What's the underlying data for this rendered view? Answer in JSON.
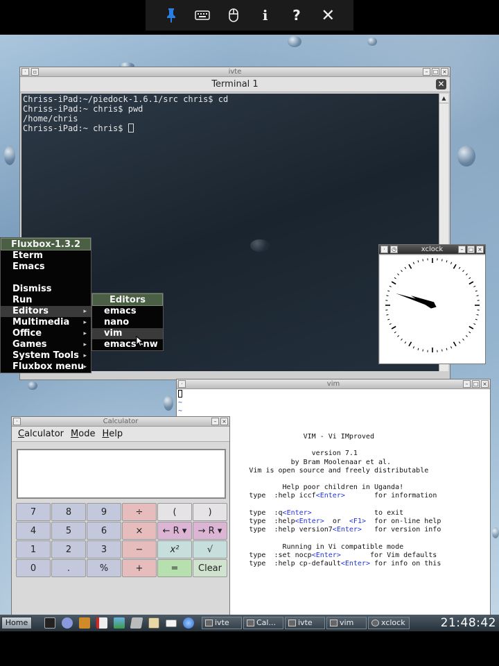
{
  "toolbar": {
    "icons": [
      "pin-icon",
      "keyboard-icon",
      "mouse-icon",
      "info-icon",
      "help-icon",
      "close-icon"
    ],
    "info_glyph": "i",
    "help_glyph": "?",
    "close_glyph": "✕",
    "accent_color": "#2a7de1"
  },
  "terminal": {
    "window_title": "ivte",
    "tab_title": "Terminal 1",
    "lines": [
      "Chriss-iPad:~/piedock-1.6.1/src chris$ cd",
      "Chriss-iPad:~ chris$ pwd",
      "/home/chris"
    ],
    "prompt": "Chriss-iPad:~ chris$ "
  },
  "fluxbox_menu": {
    "title": "Fluxbox-1.3.2",
    "items": [
      "Eterm",
      "Emacs",
      "",
      "Dismiss",
      "Run",
      "Editors",
      "Multimedia",
      "Office",
      "Games",
      "System Tools",
      "Fluxbox menu"
    ]
  },
  "editors_menu": {
    "title": "Editors",
    "items": [
      "emacs",
      "nano",
      "vim",
      "emacs -nw"
    ]
  },
  "xclock": {
    "window_title": "xclock",
    "time_shown": "21:48"
  },
  "vim": {
    "window_title": "vim",
    "tilde_lines": 2,
    "intro": [
      "VIM - Vi IMproved",
      "",
      "version 7.1",
      "by Bram Moolenaar et al.",
      "Vim is open source and freely distributable",
      "",
      "Help poor children in Uganda!"
    ],
    "help_rows": [
      {
        "type": "type",
        "cmd": ":help iccf",
        "key": "<Enter>",
        "desc": "for information"
      },
      {
        "type": "type",
        "cmd": ":q",
        "key": "<Enter>",
        "desc": "to exit"
      },
      {
        "type": "type",
        "cmd": ":help",
        "key": "<Enter>",
        "extra": "or",
        "key2": "<F1>",
        "desc": "for on-line help"
      },
      {
        "type": "type",
        "cmd": ":help version7",
        "key": "<Enter>",
        "desc": "for version info"
      },
      {
        "type": "type",
        "cmd": ":set nocp",
        "key": "<Enter>",
        "desc": "for Vim defaults"
      },
      {
        "type": "type",
        "cmd": ":help cp-default",
        "key": "<Enter>",
        "desc": "for info on this"
      }
    ],
    "compat_notice": "Running in Vi compatible mode"
  },
  "calculator": {
    "window_title": "Calculator",
    "menus": [
      "Calculator",
      "Mode",
      "Help"
    ],
    "menu_underlines": [
      "C",
      "M",
      "H"
    ],
    "display_value": "",
    "keys": [
      {
        "label": "7",
        "kind": "num"
      },
      {
        "label": "8",
        "kind": "num"
      },
      {
        "label": "9",
        "kind": "num"
      },
      {
        "label": "÷",
        "kind": "op"
      },
      {
        "label": "(",
        "kind": "fn"
      },
      {
        "label": ")",
        "kind": "fn"
      },
      {
        "label": "4",
        "kind": "num"
      },
      {
        "label": "5",
        "kind": "num"
      },
      {
        "label": "6",
        "kind": "num"
      },
      {
        "label": "×",
        "kind": "op"
      },
      {
        "label": "← R ▾",
        "kind": "mem"
      },
      {
        "label": "→ R ▾",
        "kind": "mem"
      },
      {
        "label": "1",
        "kind": "num"
      },
      {
        "label": "2",
        "kind": "num"
      },
      {
        "label": "3",
        "kind": "num"
      },
      {
        "label": "−",
        "kind": "op"
      },
      {
        "label": "x²",
        "kind": "sci"
      },
      {
        "label": "√",
        "kind": "sci"
      },
      {
        "label": "0",
        "kind": "num"
      },
      {
        "label": ".",
        "kind": "num"
      },
      {
        "label": "%",
        "kind": "num"
      },
      {
        "label": "+",
        "kind": "op"
      },
      {
        "label": "=",
        "kind": "eq"
      },
      {
        "label": "Clear",
        "kind": "clr"
      }
    ]
  },
  "taskbar": {
    "home_label": "Home",
    "launchers": [
      "terminal-icon",
      "tools-icon",
      "package-icon",
      "pdf-icon",
      "image-viewer-icon",
      "editor-icon",
      "book-icon",
      "mail-icon",
      "browser-icon"
    ],
    "tasks": [
      "ivte",
      "Cal...",
      "ivte",
      "vim",
      "xclock"
    ],
    "clock": "21:48:42"
  }
}
